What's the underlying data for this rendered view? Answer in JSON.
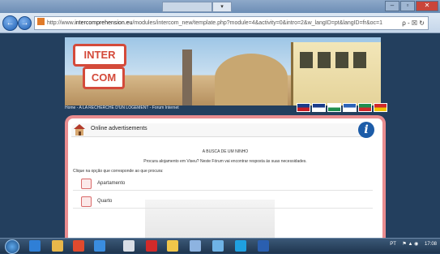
{
  "browser": {
    "tab_dropdown": "▾",
    "min_btn": "–",
    "max_btn": "▫",
    "close_btn": "✕",
    "back_icon": "←",
    "forward_icon": "→",
    "address_prefix": "http://www.",
    "address_domain": "intercomprehension.eu",
    "address_rest": "/modules/intercom_new/template.php?module=4&activity=0&intro=2&w_langID=pt&langID=fr&oc=1",
    "address_icons": "ρ - ☒ ↻"
  },
  "site": {
    "logo_top": "INTER",
    "logo_bottom": "COM",
    "breadcrumb": "Home - A LA RECHERCHE D'UN LOGEMENT - Forum Internet",
    "flags": [
      {
        "name": "flag-english",
        "c1": "#1b3c8a",
        "c2": "#c81d25"
      },
      {
        "name": "flag-french",
        "c1": "#1b3c8a",
        "c2": "#ffffff"
      },
      {
        "name": "flag-bulgarian",
        "c1": "#ffffff",
        "c2": "#1f8f4f"
      },
      {
        "name": "flag-greek",
        "c1": "#2b63b8",
        "c2": "#ffffff"
      },
      {
        "name": "flag-portuguese",
        "c1": "#1f8f4f",
        "c2": "#d0282b"
      },
      {
        "name": "flag-spanish",
        "c1": "#d0282b",
        "c2": "#f2c400"
      }
    ]
  },
  "content": {
    "header_title": "Online advertisements",
    "info_glyph": "i",
    "heading": "A BUSCA DE UM NINHO",
    "intro": "Procura alojamento em Viseu? Neste Fórum vai encontrar resposta às suas necessidades.",
    "choose": "Clique na opção que corresponde ao que procura:",
    "options": [
      "Apartamento",
      "Quarto"
    ]
  },
  "taskbar": {
    "tray_lang": "PT",
    "time": "17:08"
  }
}
